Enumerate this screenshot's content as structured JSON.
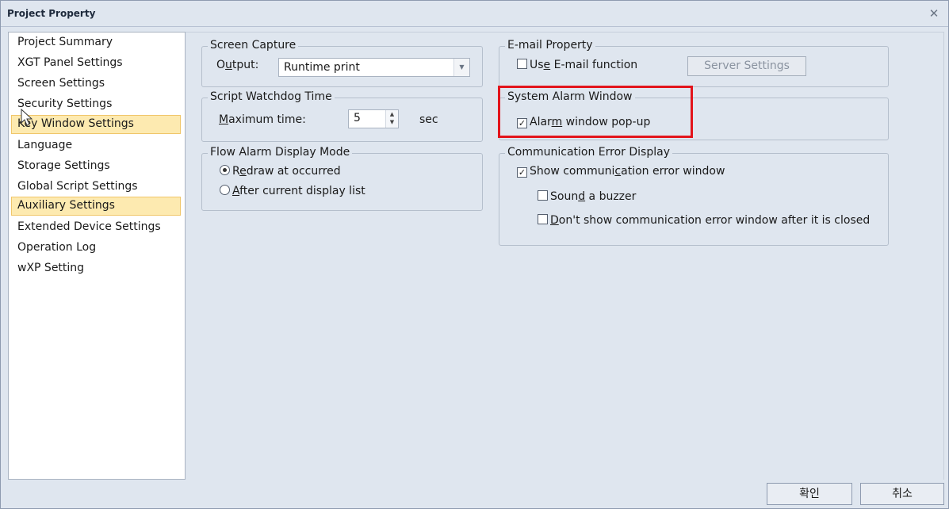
{
  "window": {
    "title": "Project Property"
  },
  "nav": {
    "items": [
      {
        "label": "Project Summary"
      },
      {
        "label": "XGT Panel Settings"
      },
      {
        "label": "Screen Settings"
      },
      {
        "label": "Security Settings"
      },
      {
        "label": "Key Window Settings"
      },
      {
        "label": "Language"
      },
      {
        "label": "Storage Settings"
      },
      {
        "label": "Global Script Settings"
      },
      {
        "label": "Auxiliary Settings"
      },
      {
        "label": "Extended Device Settings"
      },
      {
        "label": "Operation Log"
      },
      {
        "label": "wXP Setting"
      }
    ]
  },
  "screen_capture": {
    "title": "Screen Capture",
    "output_label_pre": "O",
    "output_label_u": "u",
    "output_label_post": "tput:",
    "output_value": "Runtime print"
  },
  "script_watchdog": {
    "title": "Script Watchdog Time",
    "max_label_u": "M",
    "max_label_post": "aximum time:",
    "value": "5",
    "unit": "sec"
  },
  "flow_alarm": {
    "title": "Flow Alarm Display Mode",
    "option1_pre": "R",
    "option1_u": "e",
    "option1_post": "draw at occurred",
    "option2_u": "A",
    "option2_post": "fter current display list"
  },
  "email": {
    "title": "E-mail Property",
    "use_pre": "Us",
    "use_u": "e",
    "use_post": " E-mail function",
    "server_pre": "Ser",
    "server_u": "v",
    "server_post": "er Settings"
  },
  "system_alarm": {
    "title": "System Alarm Window",
    "popup_pre": "Alar",
    "popup_u": "m",
    "popup_post": " window pop-up"
  },
  "comm_error": {
    "title": "Communication Error Display",
    "show_pre": "Show communi",
    "show_u": "c",
    "show_post": "ation error window",
    "buzzer_pre": "Soun",
    "buzzer_u": "d",
    "buzzer_post": " a buzzer",
    "dont_u": "D",
    "dont_post": "on't show communication error window after it is closed"
  },
  "footer": {
    "ok": "확인",
    "cancel": "취소"
  },
  "colors": {
    "highlight": "#e3141b",
    "selection": "#fdeab0"
  }
}
